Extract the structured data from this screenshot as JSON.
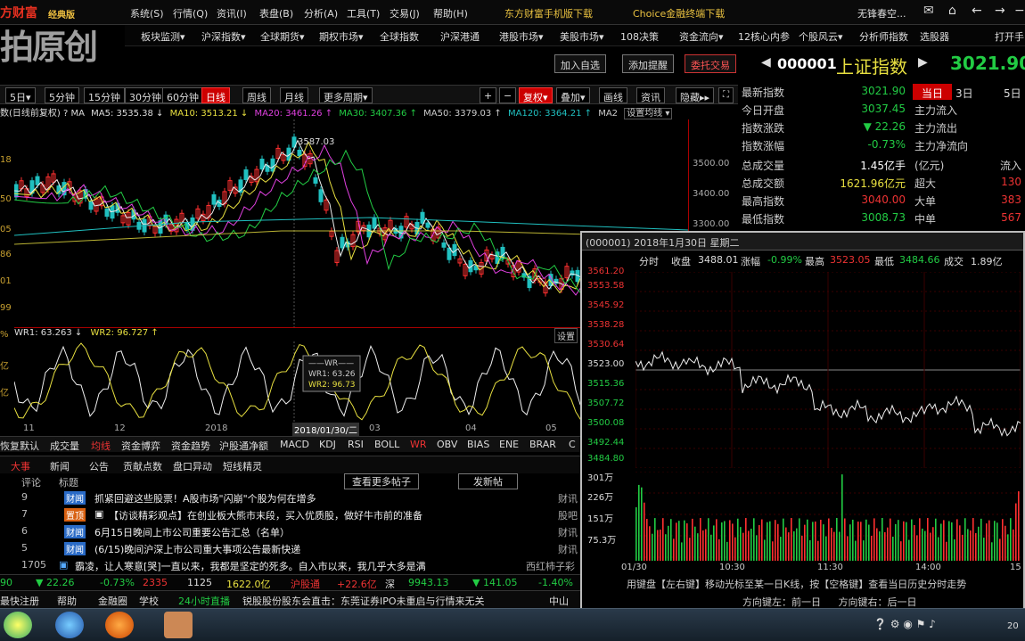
{
  "logo": {
    "brand": "方财富",
    "edition": "经典版",
    "watermark": "拍原创"
  },
  "menu": [
    "系统(S)",
    "行情(Q)",
    "资讯(I)",
    "表盘(B)",
    "分析(A)",
    "工具(T)",
    "交易(J)",
    "帮助(H)"
  ],
  "promo": [
    "东方财富手机版下载",
    "Choice金融终端下载"
  ],
  "user": "无锋春空...",
  "nav": [
    "板块监测▾",
    "沪深指数▾",
    "全球期货▾",
    "期权市场▾",
    "全球指数",
    "沪深港通",
    "港股市场▾",
    "美股市场▾",
    "108决策",
    "资金流向▾",
    "12核心内参",
    "个股风云▾",
    "分析师指数",
    "选股器",
    "打开手"
  ],
  "actions": {
    "add_watch": "加入自选",
    "add_alert": "添加提醒",
    "trade": "委托交易"
  },
  "quote": {
    "code": "000001",
    "name": "上证指数",
    "price": "3021.90"
  },
  "timeframes": [
    "5日▾",
    "5分钟",
    "15分钟",
    "30分钟",
    "60分钟",
    "日线",
    "周线",
    "月线",
    "更多周期▾"
  ],
  "tools": [
    "+",
    "−",
    "复权▾",
    "叠加▾",
    "画线",
    "资讯",
    "隐藏▸▸"
  ],
  "ma": {
    "label": "数(日线前复权) ? MA",
    "ma5": "MA5: 3535.38 ↓",
    "ma10": "MA10: 3513.21 ↓",
    "ma20": "MA20: 3461.26 ↑",
    "ma30": "MA30: 3407.36 ↑",
    "ma50": "MA50: 3379.03 ↑",
    "ma120": "MA120: 3364.21 ↑",
    "ma2": "MA2",
    "settings": "设置均线 ▾"
  },
  "peak_label": "3587.03",
  "yaxis": [
    "3500.00",
    "3400.00",
    "3300.00"
  ],
  "left_labels": [
    "18",
    "50",
    "05",
    "86",
    "01",
    "99",
    "%",
    "亿",
    "亿"
  ],
  "wr": {
    "wr1": "WR1: 63.263 ↓",
    "wr2": "WR2: 96.727 ↑",
    "box_title": "——WR——",
    "box_wr1": "WR1: 63.26",
    "box_wr2": "WR2: 96.73",
    "btn": "设置"
  },
  "xaxis": [
    "11",
    "12",
    "2018",
    "2018/01/30/二",
    "03",
    "04",
    "05"
  ],
  "indicators": [
    "恢复默认",
    "成交量",
    "均线",
    "资金博弈",
    "资金趋势",
    "沪股通净额",
    "MACD",
    "KDJ",
    "RSI",
    "BOLL",
    "WR",
    "OBV",
    "BIAS",
    "ENE",
    "BRAR",
    "C"
  ],
  "news_tabs": [
    "大事",
    "新闻",
    "公告",
    "贡献点数",
    "盘口异动",
    "短线精灵"
  ],
  "news_buttons": {
    "more": "查看更多帖子",
    "post": "发新帖"
  },
  "news_header": {
    "comments": "评论",
    "title": "标题"
  },
  "news": [
    {
      "count": "9",
      "tag": "财闻",
      "title": "抓紧回避这些股票！A股市场\"闪崩\"个股为何在增多",
      "src": "财讯"
    },
    {
      "count": "7",
      "tag": "置顶",
      "title": "【访谈精彩观点】在创业板大熊市末段，买入优质股，做好牛市前的准备",
      "src": "股吧"
    },
    {
      "count": "6",
      "tag": "财闻",
      "title": "6月15日晚间上市公司重要公告汇总（名单）",
      "src": "财讯"
    },
    {
      "count": "5",
      "tag": "财闻",
      "title": "(6/15)晚间沪深上市公司重大事项公告最新快递",
      "src": "财讯"
    },
    {
      "count": "1705",
      "tag": "",
      "title": "霸凌，让人寒意[哭]一直以来，我都是坚定的死多。自入市以来，我几乎大多是满",
      "src": "西红柿子彩"
    }
  ],
  "status": {
    "v1": "90",
    "v2": "▼ 22.26",
    "v3": "-0.73%",
    "v4": "2335",
    "v5": "1125",
    "v6": "1622.0亿",
    "v7": "沪股通",
    "v8": "+22.6亿",
    "v9": "深",
    "v10": "9943.13",
    "v11": "▼ 141.05",
    "v12": "-1.40%"
  },
  "bottom": [
    "最快注册",
    "帮助",
    "金融圈",
    "学校",
    "24小时直播",
    "锐股股份股东会直击：东莞证券IPO未重启与行情来无关",
    "中山"
  ],
  "right": {
    "rows": [
      {
        "k": "最新指数",
        "v": "3021.90",
        "k2": "当日",
        "v2": ""
      },
      {
        "k": "今日开盘",
        "v": "3037.45",
        "k2": "主力流入",
        "v2": ""
      },
      {
        "k": "指数涨跌",
        "v": "▼ 22.26",
        "k2": "主力流出",
        "v2": ""
      },
      {
        "k": "指数涨幅",
        "v": "-0.73%",
        "k2": "主力净流向",
        "v2": ""
      },
      {
        "k": "总成交量",
        "v": "1.45亿手",
        "k2": "(亿元)",
        "v2": "流入"
      },
      {
        "k": "总成交额",
        "v": "1621.96亿元",
        "k2": "超大",
        "v2": "130"
      },
      {
        "k": "最高指数",
        "v": "3040.00",
        "k2": "大单",
        "v2": "383"
      },
      {
        "k": "最低指数",
        "v": "3008.73",
        "k2": "中单",
        "v2": "567"
      }
    ],
    "tabs": [
      "当日",
      "3日",
      "5日"
    ]
  },
  "popup": {
    "title": "(000001) 2018年1月30日 星期二",
    "info": {
      "k1": "分时",
      "k2": "收盘",
      "v2": "3488.01",
      "k3": "涨幅",
      "v3": "-0.99%",
      "k4": "最高",
      "v4": "3523.05",
      "k5": "最低",
      "v5": "3484.66",
      "k6": "成交",
      "v6": "1.89亿"
    },
    "yaxis": [
      "3561.20",
      "3553.58",
      "3545.92",
      "3538.28",
      "3530.64",
      "3523.00",
      "3515.36",
      "3507.72",
      "3500.08",
      "3492.44",
      "3484.80"
    ],
    "vol_axis": [
      "301万",
      "226万",
      "151万",
      "75.3万"
    ],
    "xaxis": [
      "01/30",
      "10:30",
      "11:30",
      "14:00",
      "15"
    ],
    "foot": "用键盘【左右键】移动光标至某一日K线，按【空格键】查看当日历史分时走势",
    "foot2a": "方向键左：前一日",
    "foot2b": "方向键右：后一日"
  },
  "colors": {
    "red": "#ff3030",
    "green": "#22cc44",
    "yellow": "#e8e040",
    "accent": "#c00000"
  }
}
